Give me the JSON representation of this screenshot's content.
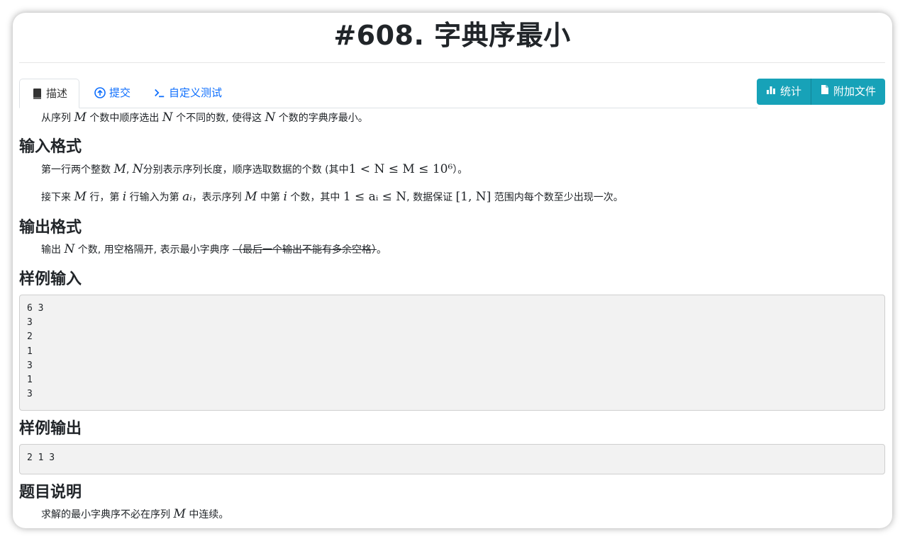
{
  "title": "#608. 字典序最小",
  "tabs": [
    {
      "label": "描述",
      "icon": "book-icon"
    },
    {
      "label": "提交",
      "icon": "upload-circle-icon"
    },
    {
      "label": "自定义测试",
      "icon": "terminal-icon"
    }
  ],
  "actions": [
    {
      "label": "统计",
      "icon": "bar-chart-icon"
    },
    {
      "label": "附加文件",
      "icon": "file-icon"
    }
  ],
  "description": {
    "p1": "从序列 M 个数中顺序选出 N 个不同的数, 使得这 N 个数的字典序最小。",
    "p1_parts": [
      "从序列 ",
      "M",
      " 个数中顺序选出 ",
      "N",
      " 个不同的数, 使得这 ",
      "N",
      " 个数的字典序最小。"
    ]
  },
  "input_format": {
    "heading": "输入格式",
    "line1_parts": [
      "第一行两个整数 ",
      "M",
      ", ",
      "N",
      "分别表示序列长度，顺序选取数据的个数 (其中",
      "1 < N ≤ M ≤ 10⁶",
      "）。"
    ],
    "line2_parts": [
      "接下来 ",
      "M",
      " 行，第 ",
      "i",
      " 行输入为第 ",
      "aᵢ",
      "，表示序列 ",
      "M",
      " 中第 ",
      "i",
      " 个数，其中 ",
      "1 ≤ aᵢ ≤ N",
      ", 数据保证 ",
      "[1, N]",
      " 范围内每个数至少出现一次。"
    ]
  },
  "output_format": {
    "heading": "输出格式",
    "parts": [
      "输出 ",
      "N",
      " 个数, 用空格隔开, 表示最小字典序 ",
      "（最后一个输出不能有多余空格）",
      "。"
    ]
  },
  "sample_input": {
    "heading": "样例输入",
    "text": "6 3\n3\n2\n1\n3\n1\n3"
  },
  "sample_output": {
    "heading": "样例输出",
    "text": "2 1 3"
  },
  "explanation": {
    "heading": "题目说明",
    "parts": [
      "求解的最小字典序不必在序列 ",
      "M",
      " 中连续。"
    ]
  },
  "colors": {
    "accent": "#17a2b8",
    "link": "#0d6efd",
    "pre_bg": "#f2f2f2"
  }
}
